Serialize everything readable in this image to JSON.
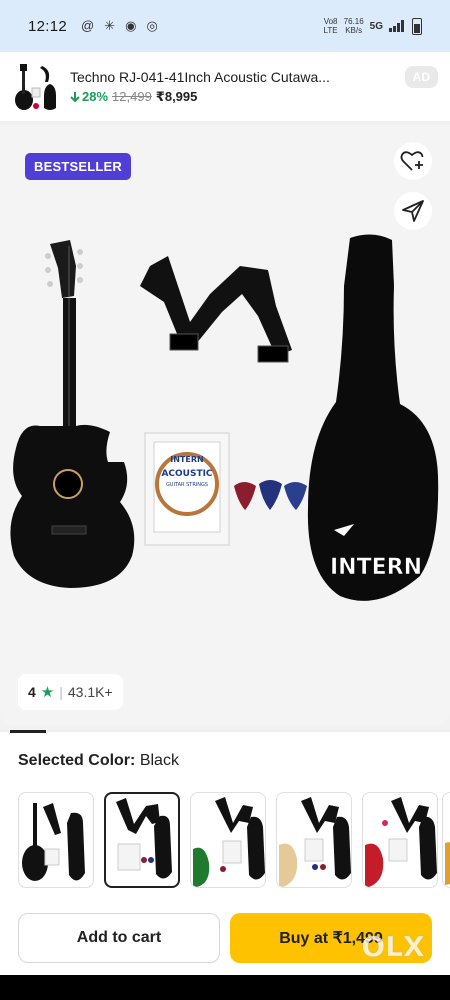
{
  "status_bar": {
    "time": "12:12",
    "network_top": "Vo8",
    "network_bottom": "LTE",
    "speed_value": "76.16",
    "speed_unit": "KB/s",
    "network_type": "5G"
  },
  "ad": {
    "title": "Techno RJ-041-41Inch Acoustic Cutawa...",
    "discount": "28%",
    "mrp": "12,499",
    "price": "₹8,995",
    "badge": "AD"
  },
  "product": {
    "badge": "BESTSELLER",
    "rating": "4",
    "rating_count": "43.1K+",
    "strings_label_brand": "INTERN",
    "strings_label_title": "ACOUSTIC",
    "strings_label_subtitle": "GUITAR STRINGS",
    "bag_brand": "INTERN"
  },
  "color_selector": {
    "label": "Selected Color:",
    "value": "Black"
  },
  "actions": {
    "add_to_cart": "Add to cart",
    "buy_now": "Buy at ₹1,499"
  },
  "watermark": "OLX",
  "colors": {
    "bestseller_bg": "#4f3fd6",
    "buy_button": "#ffc200",
    "discount_green": "#1a9c5b",
    "status_bar_bg": "#dcebfb"
  },
  "icons": {
    "wishlist": "heart-plus-icon",
    "share": "share-icon",
    "discount_arrow": "arrow-down-icon",
    "star": "star-icon"
  }
}
